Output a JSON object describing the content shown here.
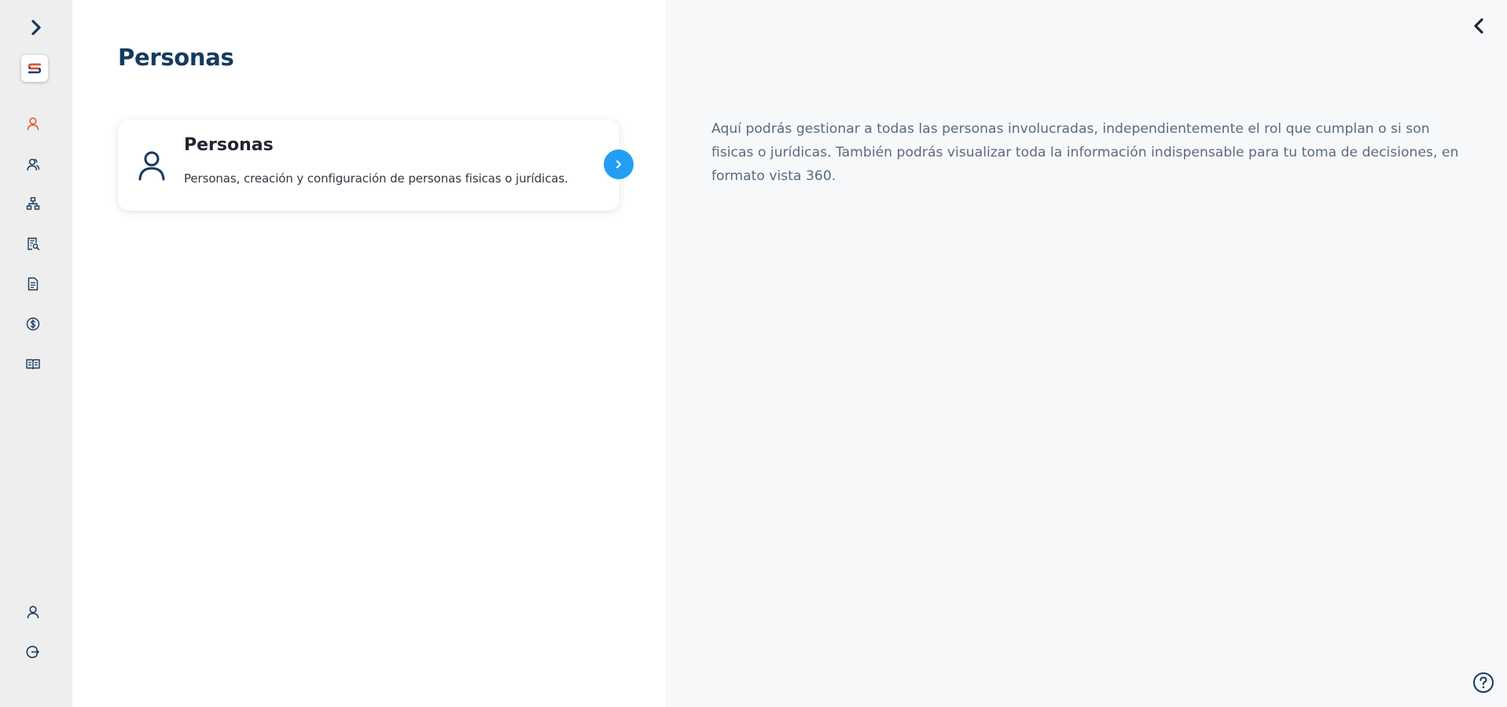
{
  "sidebar": {
    "expand_icon": "chevron-right-icon",
    "logo": "S",
    "items": [
      {
        "name": "personas",
        "icon": "person-icon",
        "active": true
      },
      {
        "name": "contacts",
        "icon": "people-icon",
        "active": false
      },
      {
        "name": "structure",
        "icon": "hierarchy-icon",
        "active": false
      },
      {
        "name": "reports",
        "icon": "document-search-icon",
        "active": false
      },
      {
        "name": "documents",
        "icon": "document-icon",
        "active": false
      },
      {
        "name": "billing",
        "icon": "dollar-icon",
        "active": false
      },
      {
        "name": "catalog",
        "icon": "book-icon",
        "active": false
      }
    ],
    "bottom_items": [
      {
        "name": "profile",
        "icon": "person-icon"
      },
      {
        "name": "logout",
        "icon": "logout-icon"
      }
    ]
  },
  "main": {
    "title": "Personas",
    "card": {
      "title": "Personas",
      "description": "Personas, creación y configuración de personas fisicas o jurídicas."
    }
  },
  "panel": {
    "text": "Aquí podrás gestionar a todas las personas involucradas, independientemente el rol que cumplan o si son fisicas o jurídicas. También podrás visualizar toda la información indispensable para tu toma de decisiones, en formato vista 360."
  },
  "colors": {
    "accent": "#229ff2",
    "active_icon": "#e8562a",
    "icon": "#163a5f",
    "sidebar_bg": "#eeeeef",
    "panel_bg": "#f6f8fa"
  }
}
